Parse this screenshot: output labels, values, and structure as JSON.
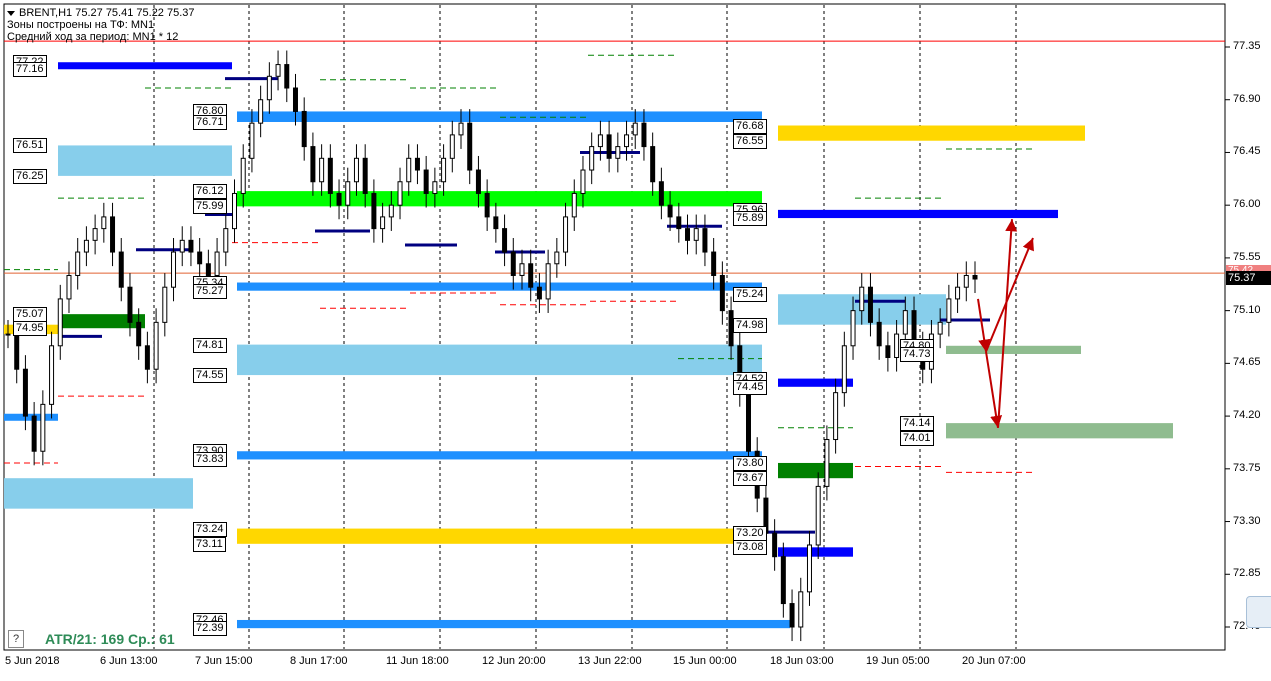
{
  "header": {
    "title": "BRENT,H1  75.27 75.41 75.22 75.37",
    "line2": "Зоны построены на ТФ: MN1",
    "line3": "Средний ход за период: MN1 * 12"
  },
  "atr_text": "ATR/21: 169  Ср.: 61",
  "help_label": "?",
  "current_price": "75.37",
  "red_price": "75.42",
  "colors": {
    "blue": "#0000ff",
    "lightblue": "#87ceeb",
    "midblue": "#1e90ff",
    "green": "#00ff00",
    "darkgreen": "#008000",
    "gold": "#ffd700",
    "sage": "#8fbc8f",
    "red": "#ff0000",
    "darkred": "#c00000",
    "navy": "#000080"
  },
  "chart_data": {
    "type": "candlestick",
    "symbol": "BRENT",
    "timeframe": "H1",
    "ohlc_last": {
      "open": 75.27,
      "high": 75.41,
      "low": 75.22,
      "close": 75.37
    },
    "ylim": [
      72.3,
      77.55
    ],
    "price_ticks": [
      "77.35",
      "76.90",
      "76.45",
      "76.00",
      "75.55",
      "75.10",
      "74.65",
      "74.20",
      "73.75",
      "73.30",
      "72.85",
      "72.40"
    ],
    "time_ticks": [
      "5 Jun 2018",
      "6 Jun 13:00",
      "7 Jun 15:00",
      "8 Jun 17:00",
      "11 Jun 18:00",
      "12 Jun 20:00",
      "13 Jun 22:00",
      "15 Jun 00:00",
      "18 Jun 03:00",
      "19 Jun 05:00",
      "20 Jun 07:00"
    ],
    "level_labels": [
      "77.22",
      "77.16",
      "76.51",
      "76.25",
      "76.80",
      "76.71",
      "76.12",
      "75.99",
      "75.34",
      "75.27",
      "75.07",
      "74.95",
      "74.81",
      "74.55",
      "73.90",
      "73.83",
      "73.24",
      "73.11",
      "72.46",
      "72.39",
      "76.68",
      "76.55",
      "75.96",
      "75.89",
      "75.24",
      "74.98",
      "74.52",
      "74.45",
      "73.80",
      "73.67",
      "73.20",
      "73.08",
      "74.80",
      "74.73",
      "74.14",
      "74.01"
    ],
    "close_path": [
      74.9,
      74.6,
      74.2,
      73.9,
      74.3,
      74.8,
      75.2,
      75.4,
      75.6,
      75.7,
      75.8,
      75.9,
      75.6,
      75.3,
      75.0,
      74.8,
      74.6,
      75.0,
      75.3,
      75.6,
      75.7,
      75.6,
      75.5,
      75.4,
      75.6,
      75.8,
      76.1,
      76.4,
      76.7,
      76.9,
      77.1,
      77.2,
      77.0,
      76.8,
      76.5,
      76.2,
      76.4,
      76.1,
      76.0,
      76.2,
      76.4,
      76.1,
      75.8,
      75.9,
      76.0,
      76.2,
      76.4,
      76.3,
      76.1,
      76.2,
      76.4,
      76.6,
      76.7,
      76.3,
      76.1,
      75.9,
      75.8,
      75.6,
      75.4,
      75.5,
      75.3,
      75.2,
      75.5,
      75.6,
      75.9,
      76.1,
      76.3,
      76.5,
      76.6,
      76.4,
      76.5,
      76.6,
      76.7,
      76.5,
      76.2,
      76.0,
      75.9,
      75.8,
      75.7,
      75.8,
      75.6,
      75.4,
      75.1,
      74.8,
      74.4,
      73.9,
      73.5,
      73.2,
      73.0,
      72.6,
      72.4,
      72.7,
      73.1,
      73.6,
      74.0,
      74.4,
      74.8,
      75.1,
      75.3,
      75.0,
      74.8,
      74.7,
      74.9,
      75.1,
      74.8,
      74.6,
      74.9,
      75.0,
      75.2,
      75.3,
      75.4,
      75.37
    ]
  }
}
